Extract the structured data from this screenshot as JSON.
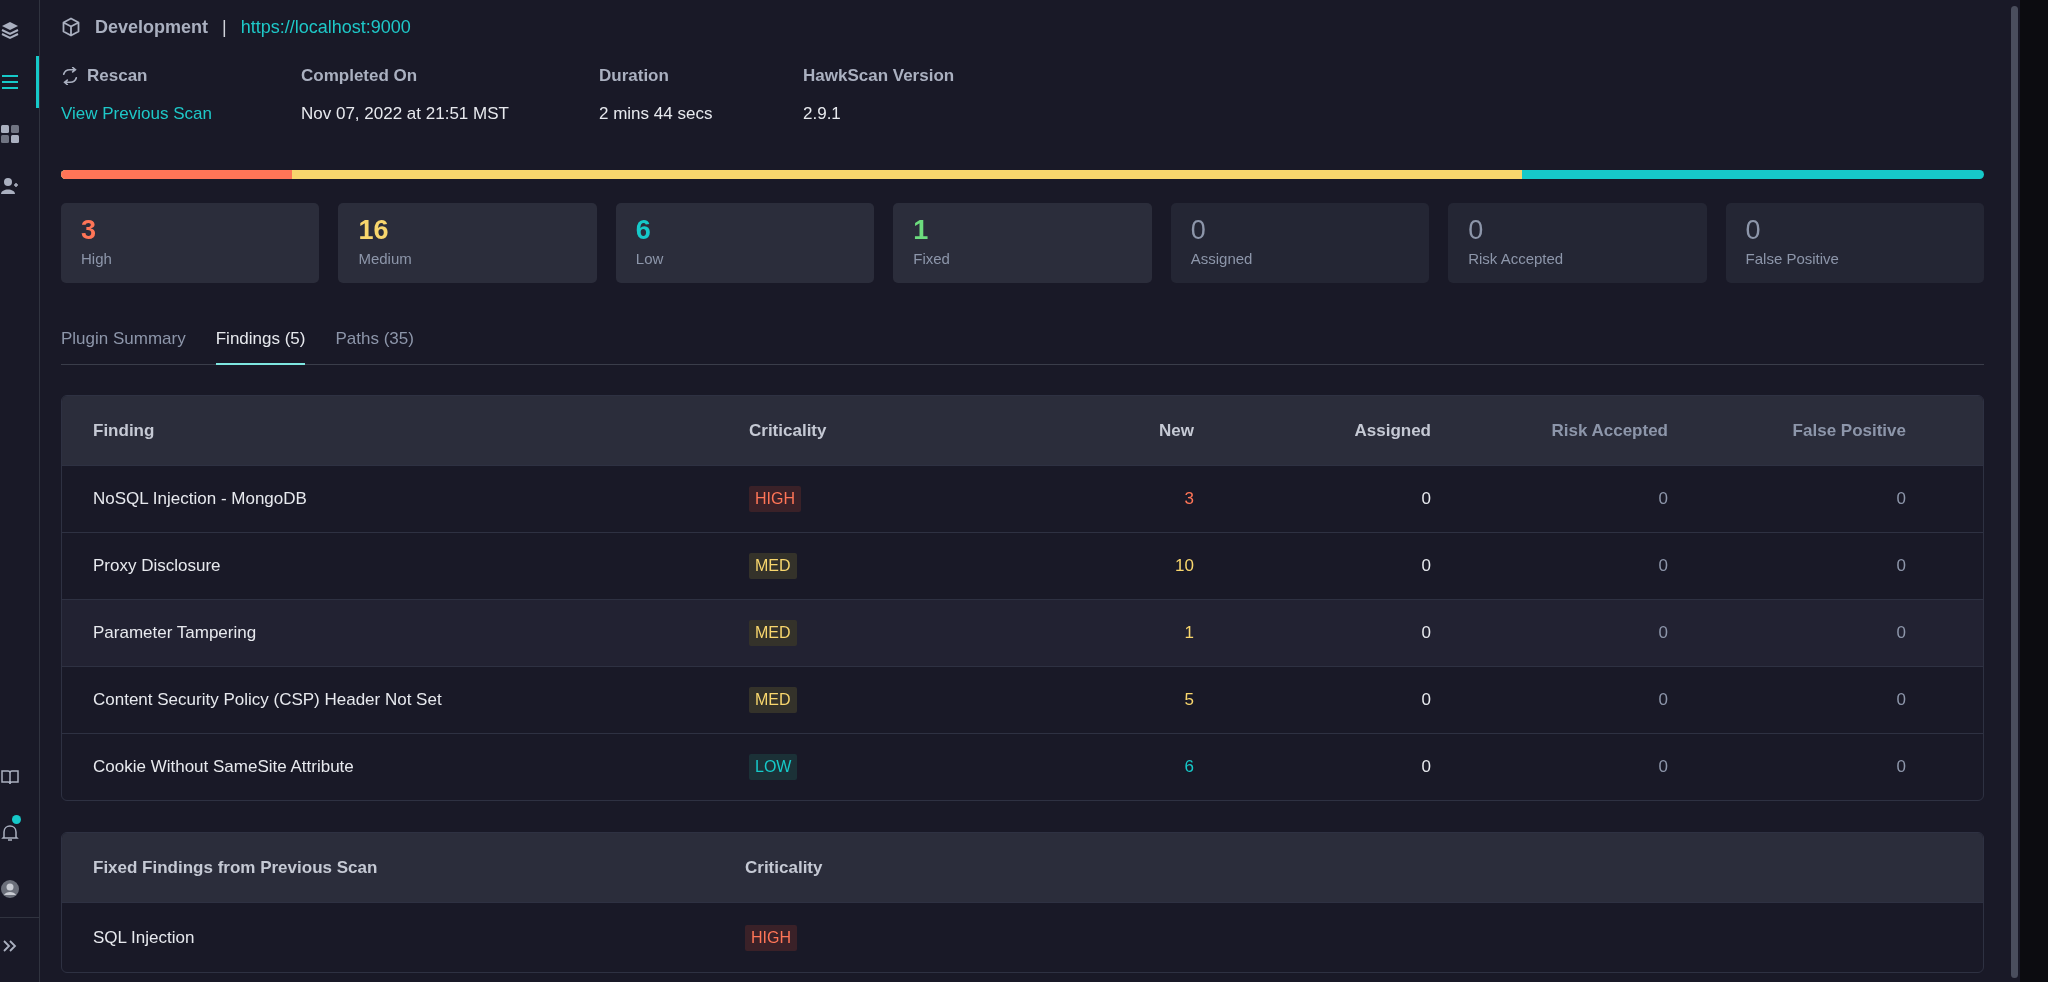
{
  "sidebar": {
    "items": [
      {
        "kind": "layers",
        "selected": false
      },
      {
        "kind": "list",
        "selected": true
      },
      {
        "kind": "grid",
        "selected": false
      },
      {
        "kind": "user-add",
        "selected": false
      }
    ],
    "bottom_items": [
      {
        "kind": "book",
        "notification": false
      },
      {
        "kind": "bell",
        "notification": true
      },
      {
        "kind": "avatar",
        "notification": false
      },
      {
        "kind": "expand",
        "notification": false
      }
    ]
  },
  "environment": {
    "name": "Development",
    "separator": "|",
    "url": "https://localhost:9000"
  },
  "scan_info": {
    "rescan": "Rescan",
    "previous_scan_link": "View Previous Scan",
    "fields": [
      {
        "label": "Completed On",
        "value": "Nov 07, 2022 at 21:51 MST"
      },
      {
        "label": "Duration",
        "value": "2 mins 44 secs"
      },
      {
        "label": "HawkScan Version",
        "value": "2.9.1"
      }
    ]
  },
  "severity_bar": {
    "kind": "low",
    "fills": [
      {
        "kind": "medium",
        "level": 0.76
      },
      {
        "kind": "high",
        "level": 0.12
      }
    ]
  },
  "stats": [
    {
      "value": "3",
      "label": "High",
      "color": "#ff7557"
    },
    {
      "value": "16",
      "label": "Medium",
      "color": "#f8d66d"
    },
    {
      "value": "6",
      "label": "Low",
      "color": "#16c9c9"
    },
    {
      "value": "1",
      "label": "Fixed",
      "color": "#6ddc7e"
    },
    {
      "value": "0",
      "label": "Assigned",
      "color": "#8d96aa"
    },
    {
      "value": "0",
      "label": "Risk Accepted",
      "color": "#8d96aa"
    },
    {
      "value": "0",
      "label": "False Positive",
      "color": "#8d96aa"
    }
  ],
  "tabs": [
    {
      "label": "Plugin Summary",
      "selected": false
    },
    {
      "label": "Findings (5)",
      "selected": true
    },
    {
      "label": "Paths (35)",
      "selected": false
    }
  ],
  "findings_table": {
    "columns": [
      {
        "label": "Finding",
        "dimmed": false
      },
      {
        "label": "Criticality",
        "dimmed": false
      },
      {
        "label": "New",
        "dimmed": false
      },
      {
        "label": "Assigned",
        "dimmed": false
      },
      {
        "label": "Risk Accepted",
        "dimmed": true
      },
      {
        "label": "False Positive",
        "dimmed": true
      }
    ],
    "rows": [
      {
        "finding": "NoSQL Injection - MongoDB",
        "criticality": "HIGH",
        "kind": "high",
        "new": "3",
        "assigned": "0",
        "risk_accepted": "0",
        "false_positive": "0",
        "highlighted": false
      },
      {
        "finding": "Proxy Disclosure",
        "criticality": "MED",
        "kind": "medium",
        "new": "10",
        "assigned": "0",
        "risk_accepted": "0",
        "false_positive": "0",
        "highlighted": false
      },
      {
        "finding": "Parameter Tampering",
        "criticality": "MED",
        "kind": "medium",
        "new": "1",
        "assigned": "0",
        "risk_accepted": "0",
        "false_positive": "0",
        "highlighted": true
      },
      {
        "finding": "Content Security Policy (CSP) Header Not Set",
        "criticality": "MED",
        "kind": "medium",
        "new": "5",
        "assigned": "0",
        "risk_accepted": "0",
        "false_positive": "0",
        "highlighted": false
      },
      {
        "finding": "Cookie Without SameSite Attribute",
        "criticality": "LOW",
        "kind": "low",
        "new": "6",
        "assigned": "0",
        "risk_accepted": "0",
        "false_positive": "0",
        "highlighted": false
      }
    ]
  },
  "fixed_table": {
    "columns": [
      "Fixed Findings from Previous Scan",
      "Criticality"
    ],
    "rows": [
      {
        "finding": "SQL Injection",
        "criticality": "HIGH",
        "kind": "high"
      }
    ]
  }
}
